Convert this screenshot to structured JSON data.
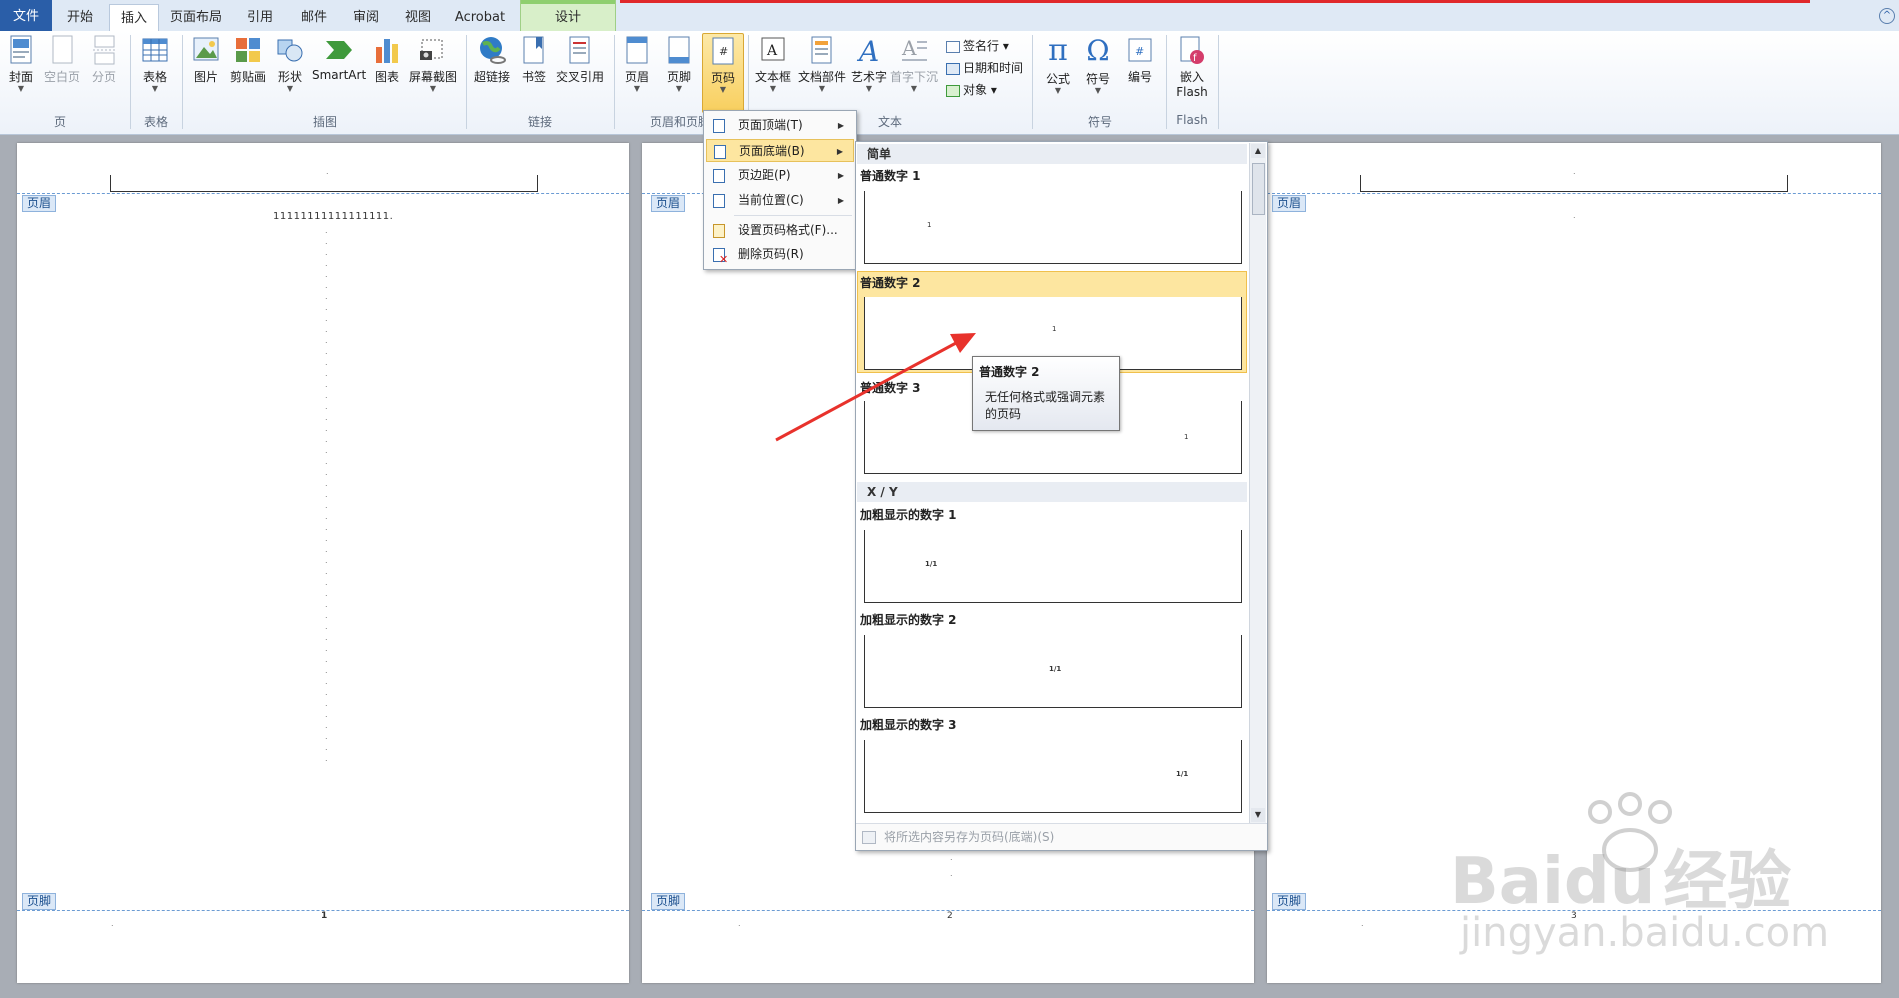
{
  "tabs": {
    "file": "文件",
    "home": "开始",
    "insert": "插入",
    "layout": "页面布局",
    "references": "引用",
    "mailings": "邮件",
    "review": "审阅",
    "view": "视图",
    "acrobat": "Acrobat",
    "design": "设计"
  },
  "ribbon": {
    "cover": "封面",
    "blank_page": "空白页",
    "page_break": "分页",
    "table": "表格",
    "picture": "图片",
    "clipart": "剪贴画",
    "shapes": "形状",
    "smartart": "SmartArt",
    "chart": "图表",
    "screenshot": "屏幕截图",
    "hyperlink": "超链接",
    "bookmark": "书签",
    "cross_ref": "交叉引用",
    "header": "页眉",
    "footer": "页脚",
    "page_number": "页码",
    "textbox": "文本框",
    "quick_parts": "文档部件",
    "wordart": "艺术字",
    "dropcap": "首字下沉",
    "signature_line": "签名行",
    "date_time": "日期和时间",
    "object": "对象",
    "equation": "公式",
    "symbol": "符号",
    "numbering": "编号",
    "embed": "嵌入",
    "flash": "Flash",
    "groups": {
      "pages": "页",
      "tables": "表格",
      "illustrations": "插图",
      "links": "链接",
      "header_footer": "页眉和页脚",
      "text": "文本",
      "symbols": "符号",
      "flash": "Flash"
    }
  },
  "menu": {
    "top": "页面顶端(T)",
    "bottom": "页面底端(B)",
    "margins": "页边距(P)",
    "current": "当前位置(C)",
    "format": "设置页码格式(F)...",
    "remove": "删除页码(R)"
  },
  "gallery": {
    "cat_simple": "简单",
    "plain1": "普通数字 1",
    "plain2": "普通数字 2",
    "plain3": "普通数字 3",
    "cat_xy": "X / Y",
    "bold1": "加粗显示的数字 1",
    "bold2": "加粗显示的数字 2",
    "bold3": "加粗显示的数字 3",
    "prev_plain": "1",
    "prev_xy": "1/1",
    "footer_save": "将所选内容另存为页码(底端)(S)"
  },
  "tooltip": {
    "title": "普通数字 2",
    "desc": "无任何格式或强调元素的页码"
  },
  "doc": {
    "header_tag": "页眉",
    "footer_tag": "页脚",
    "body_text": "11111111111111111.",
    "page1_num": "1",
    "page2_num": "2",
    "page3_num": "3"
  },
  "watermark": {
    "brand": "Bai",
    "brand2": "du",
    "brand_cn": "经验",
    "url": "jingyan.baidu.com"
  },
  "colors": {
    "accent": "#2a5ea8",
    "highlight": "#fde6a0",
    "arrow": "#e8322c"
  }
}
